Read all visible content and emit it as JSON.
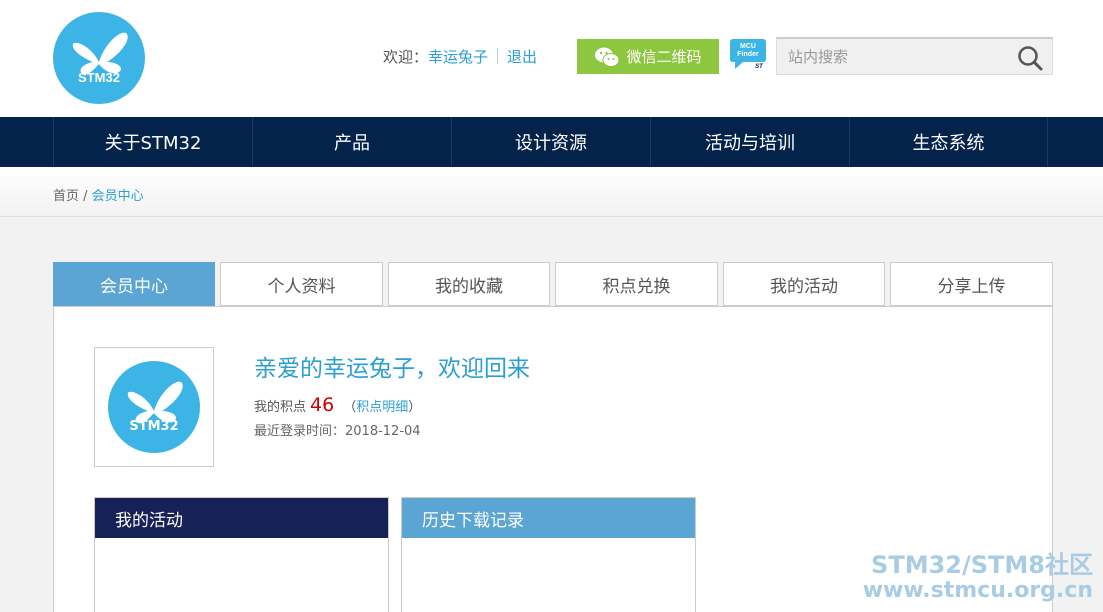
{
  "header": {
    "logo_text": "STM32",
    "welcome_label": "欢迎：",
    "username": "幸运兔子",
    "logout": "退出",
    "wechat_button": "微信二维码",
    "mcu_finder_line1": "MCU",
    "mcu_finder_line2": "Finder",
    "search_placeholder": "站内搜索"
  },
  "nav": {
    "items": [
      "关于STM32",
      "产品",
      "设计资源",
      "活动与培训",
      "生态系统"
    ]
  },
  "breadcrumb": {
    "home": "首页",
    "separator": " / ",
    "current": "会员中心"
  },
  "tabs": [
    "会员中心",
    "个人资料",
    "我的收藏",
    "积点兑换",
    "我的活动",
    "分享上传"
  ],
  "profile": {
    "avatar_text": "STM32",
    "greeting": "亲爱的幸运兔子，欢迎回来",
    "points_label": "我的积点",
    "points_value": "46",
    "points_detail_open": "（",
    "points_detail": "积点明细",
    "points_detail_close": "）",
    "last_login": "最近登录时间：2018-12-04"
  },
  "panels": {
    "activity_title": "我的活动",
    "download_title": "历史下载记录"
  },
  "watermark": {
    "line1": "STM32/STM8社区",
    "line2": "www.stmcu.org.cn"
  },
  "colors": {
    "brand_blue": "#3cb4e5",
    "nav_bg": "#03234b",
    "link": "#2a9fd6",
    "wechat_green": "#8dc63f",
    "tab_active": "#5aa5d4",
    "panel_dark": "#152157",
    "points_red": "#cc0000"
  }
}
